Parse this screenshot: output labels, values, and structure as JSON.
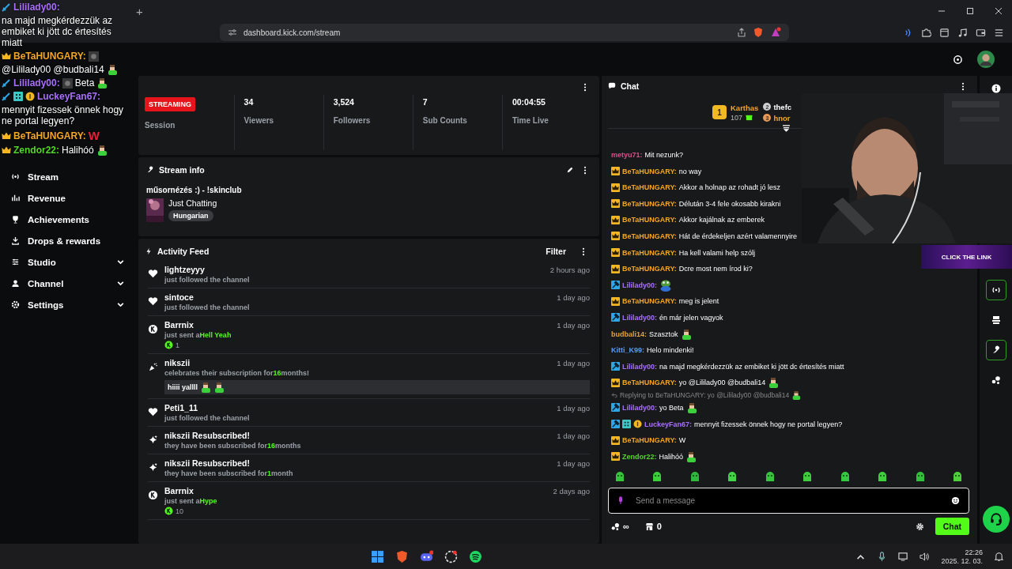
{
  "browser": {
    "new_tab": "+",
    "url": "dashboard.kick.com/stream"
  },
  "overlay_chat": [
    {
      "kind": "text",
      "name": "Lililady00:",
      "color": "#a970ff",
      "moderator": true,
      "text": "na majd megkérdezzük az embiket ki jött dc értesítés miatt"
    },
    {
      "kind": "text",
      "name": "BeTaHUNGARY:",
      "color": "#f5a623",
      "vip": true,
      "thumb": true,
      "text": "@Lililady00 @budbali14",
      "emote": true
    },
    {
      "kind": "text",
      "name": "Lililady00:",
      "color": "#a970ff",
      "moderator": true,
      "thumb": true,
      "text": "Beta",
      "emote": true
    },
    {
      "kind": "text",
      "name": "LuckeyFan67:",
      "color": "#a970ff",
      "moderator": true,
      "subscriber": true,
      "gifter": true,
      "text": "mennyit fizessek önnek hogy ne portal legyen?"
    },
    {
      "kind": "shout",
      "name": "BeTaHUNGARY:",
      "color": "#f5a623",
      "vip": true,
      "text": "W"
    },
    {
      "kind": "text",
      "name": "Zendor22:",
      "color": "#53d62a",
      "vip": true,
      "text": "Halihóó",
      "emote": true
    }
  ],
  "sidebar": {
    "items": [
      {
        "label": "Stream",
        "kind": "link"
      },
      {
        "label": "Revenue",
        "kind": "link"
      },
      {
        "label": "Achievements",
        "kind": "link"
      },
      {
        "label": "Drops & rewards",
        "kind": "link"
      },
      {
        "label": "Studio",
        "kind": "group",
        "expanded": false
      },
      {
        "label": "Channel",
        "kind": "group",
        "expanded": false
      },
      {
        "label": "Settings",
        "kind": "group",
        "expanded": false
      }
    ]
  },
  "session": {
    "status": "STREAMING",
    "label": "Session",
    "stats": [
      {
        "value": "34",
        "label": "Viewers"
      },
      {
        "value": "3,524",
        "label": "Followers"
      },
      {
        "value": "7",
        "label": "Sub Counts"
      },
      {
        "value": "00:04:55",
        "label": "Time Live"
      }
    ]
  },
  "stream_info": {
    "heading": "Stream info",
    "title": "műsornézés :) - !skinclub",
    "category": "Just Chatting",
    "tag": "Hungarian"
  },
  "activity_feed": {
    "heading": "Activity Feed",
    "filter": "Filter",
    "items": [
      {
        "kind": "follow",
        "user": "lightzeyyy",
        "time": "2 hours ago",
        "text": "just followed the channel"
      },
      {
        "kind": "follow",
        "user": "sintoce",
        "time": "1 day ago",
        "text": "just followed the channel"
      },
      {
        "kind": "gift",
        "user": "Barrnix",
        "time": "1 day ago",
        "text": "just sent a",
        "highlight": "Hell Yeah",
        "amount": "1"
      },
      {
        "kind": "celebrate",
        "user": "nikszii",
        "time": "1 day ago",
        "text": "celebrates their subscription for",
        "highlight": "16",
        "suffix": "months!",
        "message": "hiiii yallll"
      },
      {
        "kind": "follow",
        "user": "Peti1_11",
        "time": "1 day ago",
        "text": "just followed the channel"
      },
      {
        "kind": "resub",
        "user": "nikszii Resubscribed!",
        "time": "1 day ago",
        "text": "they have been subscribed for",
        "highlight": "16",
        "suffix": "months"
      },
      {
        "kind": "resub",
        "user": "nikszii Resubscribed!",
        "time": "1 day ago",
        "text": "they have been subscribed for",
        "highlight": "1",
        "suffix": "month"
      },
      {
        "kind": "gift",
        "user": "Barrnix",
        "time": "2 days ago",
        "text": "just sent a",
        "highlight": "Hype",
        "amount": "10"
      }
    ]
  },
  "chat": {
    "heading": "Chat",
    "leaderboard": [
      {
        "rank": "1",
        "name": "Karthas",
        "amount": "107"
      },
      {
        "rank": "2",
        "name": "thefc"
      },
      {
        "rank": "3",
        "name": "hnor"
      }
    ],
    "messages": [
      {
        "name": "metyu71:",
        "color": "#d9508c",
        "text": "Mit nezunk?"
      },
      {
        "name": "BeTaHUNGARY:",
        "color": "#f5a623",
        "vip": true,
        "text": "no way"
      },
      {
        "name": "BeTaHUNGARY:",
        "color": "#f5a623",
        "vip": true,
        "text": "Akkor a holnap az rohadt jó lesz"
      },
      {
        "name": "BeTaHUNGARY:",
        "color": "#f5a623",
        "vip": true,
        "text": "Délután 3-4 fele okosabb kirakni"
      },
      {
        "name": "BeTaHUNGARY:",
        "color": "#f5a623",
        "vip": true,
        "text": "Akkor kajálnak az emberek"
      },
      {
        "name": "BeTaHUNGARY:",
        "color": "#f5a623",
        "vip": true,
        "text": "Hát de érdekeljen azért valamennyire"
      },
      {
        "name": "BeTaHUNGARY:",
        "color": "#f5a623",
        "vip": true,
        "text": "Ha kell valami help szólj"
      },
      {
        "name": "BeTaHUNGARY:",
        "color": "#f5a623",
        "vip": true,
        "text": "Dcre most nem írod ki?"
      },
      {
        "name": "Lililady00:",
        "color": "#a970ff",
        "moderator": true,
        "frog_emote": true
      },
      {
        "name": "BeTaHUNGARY:",
        "color": "#f5a623",
        "vip": true,
        "text": "meg is jelent"
      },
      {
        "name": "Lililady00:",
        "color": "#a970ff",
        "moderator": true,
        "text": "én már jelen vagyok"
      },
      {
        "name": "budbali14:",
        "color": "#e3a13a",
        "text": "Szasztok",
        "emote": true
      },
      {
        "name": "Kitti_K99:",
        "color": "#5b9cf5",
        "text": "Helo mindenki!"
      },
      {
        "name": "Lililady00:",
        "color": "#a970ff",
        "moderator": true,
        "text": "na majd megkérdezzük az embiket ki jött dc értesítés miatt"
      },
      {
        "name": "BeTaHUNGARY:",
        "color": "#f5a623",
        "vip": true,
        "text": "yo @Lililady00 @budbali14",
        "emote": true
      },
      {
        "name": "Lililady00:",
        "color": "#a970ff",
        "moderator": true,
        "reply_to": "Replying to BeTaHUNGARY: yo @Lililady00 @budbali14",
        "text": "yo Beta",
        "emote": true
      },
      {
        "name": "LuckeyFan67:",
        "color": "#a970ff",
        "moderator": true,
        "subscriber": true,
        "gifter": true,
        "text": "mennyit fizessek önnek hogy ne portal legyen?"
      },
      {
        "name": "BeTaHUNGARY:",
        "color": "#f5a623",
        "vip": true,
        "text": "W"
      },
      {
        "name": "Zendor22:",
        "color": "#53d62a",
        "vip": true,
        "text": "Halihóó",
        "emote": true
      }
    ],
    "placeholder": "Send a message",
    "points": "∞",
    "store_count": "0",
    "send": "Chat"
  },
  "promo_banner": "CLICK THE LINK",
  "taskbar": {
    "time": "22:26",
    "date": "2025. 12. 03."
  }
}
